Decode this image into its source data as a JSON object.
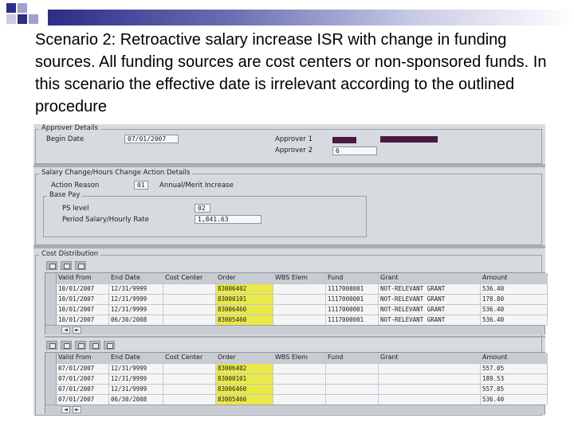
{
  "slide": {
    "title": "Scenario 2: Retroactive salary increase ISR with change in funding sources.  All funding sources are cost centers or non-sponsored funds.  In this scenario the effective date is irrelevant according to the outlined procedure"
  },
  "approver": {
    "group_title": "Approver Details",
    "begin_date_label": "Begin Date",
    "begin_date_value": "07/01/2007",
    "approver1_label": "Approver 1",
    "approver2_label": "Approver 2",
    "approver2_value": "6"
  },
  "salary": {
    "group_title": "Salary Change/Hours Change Action Details",
    "action_reason_label": "Action Reason",
    "action_reason_code": "01",
    "action_reason_text": "Annual/Merit Increase",
    "base_pay": {
      "group_title": "Base Pay",
      "ps_level_label": "PS level",
      "ps_level_value": "02",
      "period_salary_label": "Period Salary/Hourly Rate",
      "period_salary_value": "1,841.63"
    }
  },
  "cost_distribution": {
    "group_title": "Cost Distribution",
    "columns": [
      "Valid From",
      "End Date",
      "Cost Center",
      "Order",
      "WBS Elem",
      "Fund",
      "Grant",
      "Amount"
    ],
    "table1": [
      [
        "10/01/2007",
        "12/31/9999",
        "",
        "83006402",
        "",
        "1117000001",
        "NOT-RELEVANT GRANT",
        "536.40"
      ],
      [
        "10/01/2007",
        "12/31/9999",
        "",
        "83000101",
        "",
        "1117000001",
        "NOT-RELEVANT GRANT",
        "178.80"
      ],
      [
        "10/01/2007",
        "12/31/9999",
        "",
        "83006460",
        "",
        "1117000001",
        "NOT-RELEVANT GRANT",
        "536.40"
      ],
      [
        "10/01/2007",
        "06/30/2008",
        "",
        "83005460",
        "",
        "1117000001",
        "NOT-RELEVANT GRANT",
        "536.40"
      ]
    ],
    "table2": [
      [
        "07/01/2007",
        "12/31/9999",
        "",
        "83006402",
        "",
        "",
        "",
        "557.05"
      ],
      [
        "07/01/2007",
        "12/31/9999",
        "",
        "83000101",
        "",
        "",
        "",
        "189.53"
      ],
      [
        "07/01/2007",
        "12/31/9999",
        "",
        "83006460",
        "",
        "",
        "",
        "557.85"
      ],
      [
        "07/01/2007",
        "06/30/2008",
        "",
        "83005460",
        "",
        "",
        "",
        "536.40"
      ]
    ],
    "nav_prev_label": "◄",
    "nav_next_label": "►"
  },
  "colors": {
    "highlight": "#e9ea4a",
    "redaction": "#4a1a44",
    "deco_dark": "#2a2e86"
  },
  "icons": [
    "table-settings-icon",
    "select-all-icon",
    "deselect-icon",
    "details-icon",
    "delete-row-icon"
  ]
}
